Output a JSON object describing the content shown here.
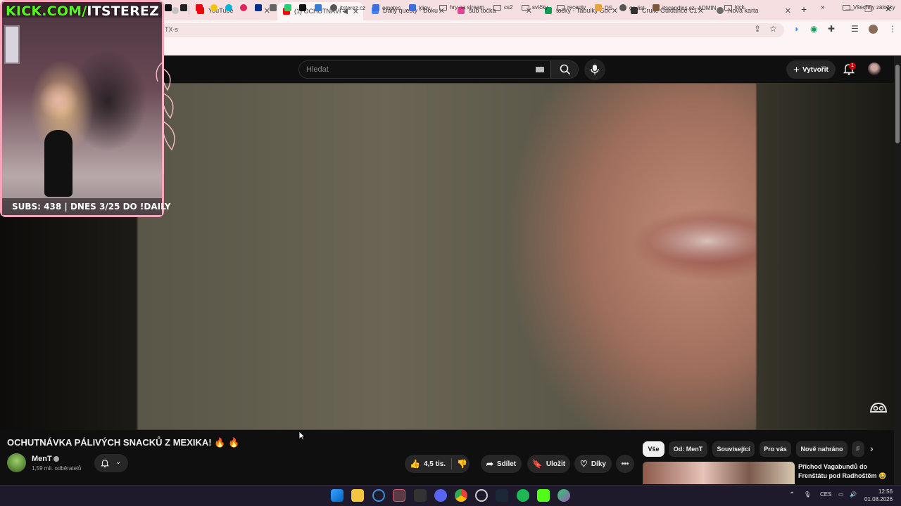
{
  "browser": {
    "tabs": [
      {
        "label": "",
        "favicon_color": "#9aa0a6"
      },
      {
        "label": "YouTube",
        "favicon_color": "#ff0000"
      },
      {
        "label": "(1) OCHUTNÁVK",
        "favicon_color": "#ff0000"
      },
      {
        "label": "Daily questy - Dokum",
        "favicon_color": "#4285f4"
      },
      {
        "label": "sub točka",
        "favicon_color": "#e84393"
      },
      {
        "label": "točky - Tabulky Goog",
        "favicon_color": "#0f9d58"
      },
      {
        "label": "Crullé Guidance C1",
        "favicon_color": "#333333"
      },
      {
        "label": "Nová karta",
        "favicon_color": "#6b6b6b"
      }
    ],
    "new_tab_glyph": "+",
    "address": "TX-s",
    "bookmarks": [
      {
        "label": "itsterez.cz",
        "icon": "globe-icon"
      },
      {
        "label": "emotes",
        "icon": "sl-icon"
      },
      {
        "label": "klipy",
        "icon": "sl-icon"
      },
      {
        "label": "hry na stream",
        "icon": "folder-icon"
      },
      {
        "label": "cs2",
        "icon": "folder-icon"
      },
      {
        "label": "svíčky",
        "icon": "folder-icon"
      },
      {
        "label": "recepty",
        "icon": "folder-icon"
      },
      {
        "label": "DS",
        "icon": "ds-icon"
      },
      {
        "label": "ga-list",
        "icon": "globe-icon"
      },
      {
        "label": "itscandles.cz -ADMIN",
        "icon": "candle-icon"
      },
      {
        "label": "kick",
        "icon": "folder-icon"
      }
    ],
    "all_bookmarks": "Všechny záložky",
    "more_bookmarks": "»"
  },
  "youtube": {
    "search_placeholder": "Hledat",
    "create_label": "Vytvořit",
    "notification_count": "1",
    "video_title": "OCHUTNÁVKA PÁLIVÝCH SNACKŮ Z MEXIKA! 🔥 🔥",
    "channel_name": "MenT",
    "subscribers": "1,59 mil. odběratelů",
    "likes": "4,5 tis.",
    "share_label": "Sdílet",
    "save_label": "Uložit",
    "thanks_label": "Díky",
    "chips": [
      "Vše",
      "Od: MenT",
      "Související",
      "Pro vás",
      "Nově nahráno",
      "F"
    ],
    "recommendation_title": "Příchod Vagabundů do Frenštátu pod Radhoštěm 😂"
  },
  "overlay": {
    "kick_prefix": "KICK.COM/",
    "kick_handle": "ITSTEREZ",
    "subs_text": "SUBS: 438 | DNES 3/25 DO !DAILY"
  },
  "taskbar": {
    "language": "CES",
    "time": "12:56",
    "date": "01.08.2026"
  },
  "colors": {
    "kick_green": "#53fc18",
    "overlay_border": "#f4a6b9",
    "youtube_bg": "#0f0f0f"
  }
}
